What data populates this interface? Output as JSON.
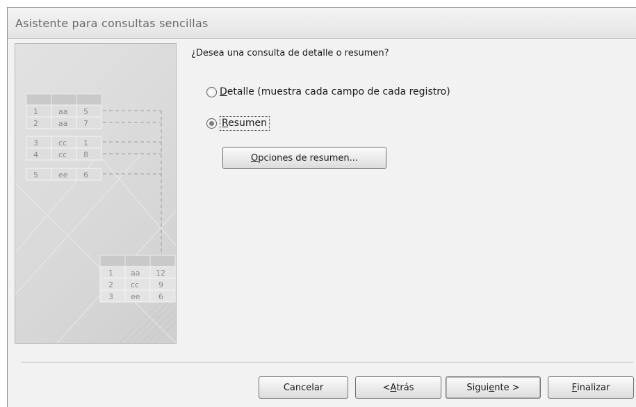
{
  "window": {
    "title": "Asistente para consultas sencillas"
  },
  "illustration": {
    "detail_rows": [
      [
        "1",
        "aa",
        "5"
      ],
      [
        "2",
        "aa",
        "7"
      ],
      [
        "3",
        "cc",
        "1"
      ],
      [
        "4",
        "cc",
        "8"
      ],
      [
        "5",
        "ee",
        "6"
      ]
    ],
    "summary_rows": [
      [
        "1",
        "aa",
        "12"
      ],
      [
        "2",
        "cc",
        "9"
      ],
      [
        "3",
        "ee",
        "6"
      ]
    ]
  },
  "main": {
    "question": "¿Desea una consulta de detalle o resumen?",
    "options": [
      {
        "accel": "D",
        "rest": "etalle (muestra cada campo de cada registro)",
        "checked": false
      },
      {
        "accel": "R",
        "rest": "esumen",
        "checked": true
      }
    ],
    "summary_button": {
      "accel": "O",
      "rest": "pciones de resumen..."
    }
  },
  "footer": {
    "cancel": "Cancelar",
    "back": {
      "pre": "< ",
      "accel": "A",
      "post": "trás"
    },
    "next": {
      "pre": "Sigui",
      "accel": "e",
      "post": "nte >"
    },
    "finish": {
      "pre": "",
      "accel": "F",
      "post": "inalizar"
    }
  },
  "colors": {
    "dialog_bg": "#f2f2f2",
    "title_text": "#6a6a6a",
    "panel_text": "#8a8a8a"
  }
}
